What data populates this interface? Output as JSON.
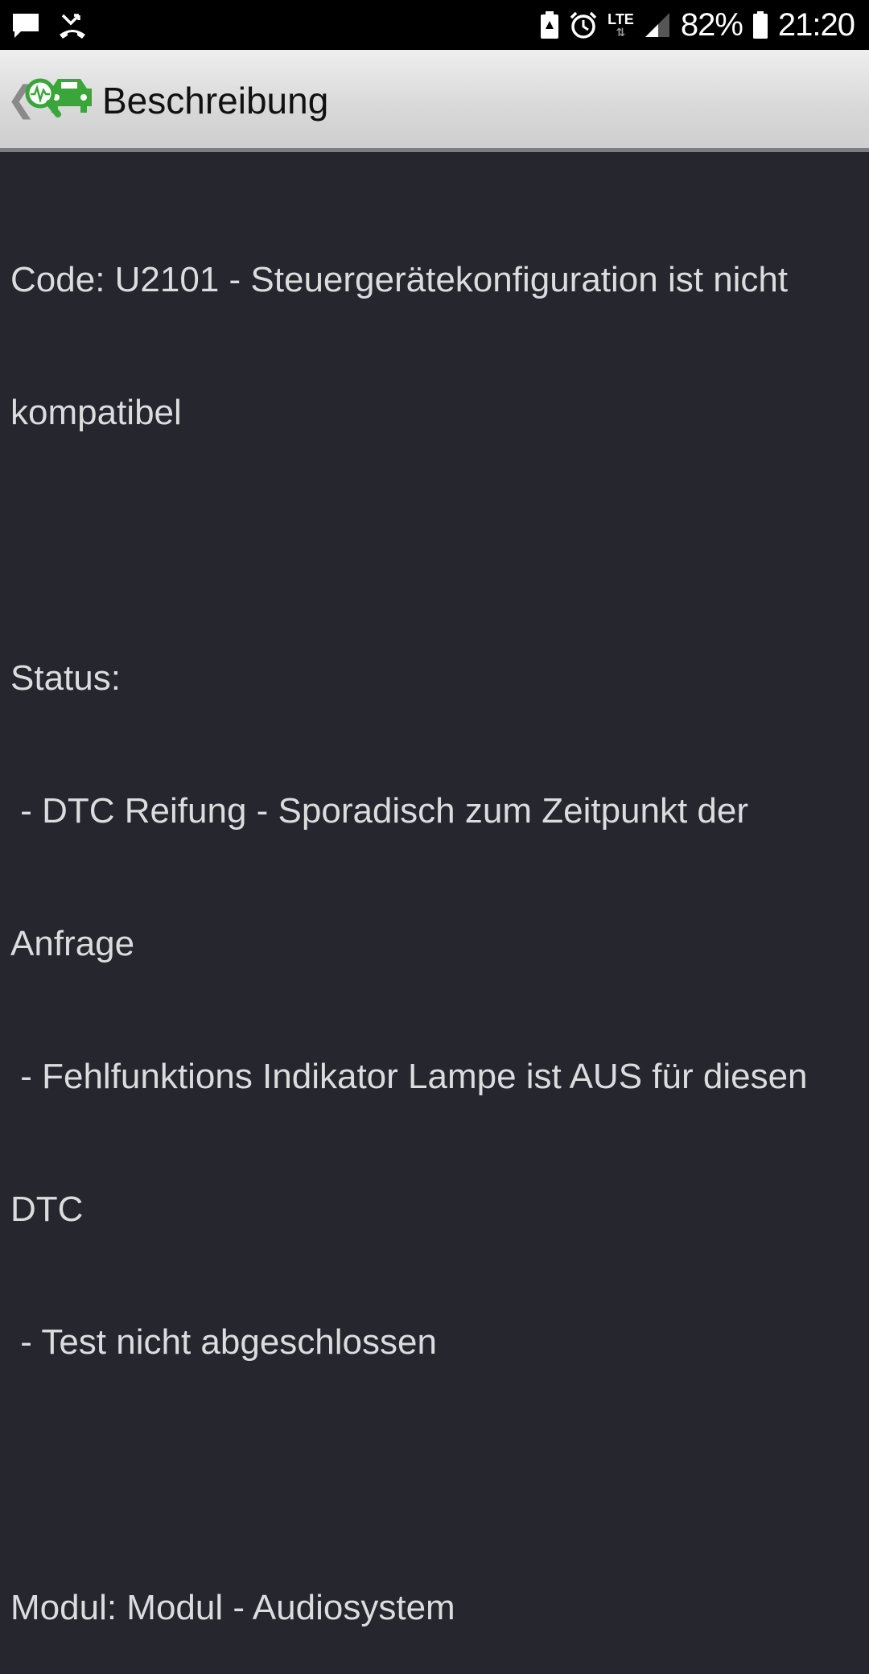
{
  "status_bar": {
    "left_icons": [
      "chat-icon",
      "missed-call-icon"
    ],
    "right_icons": [
      "battery-saver-icon",
      "alarm-icon",
      "lte-icon",
      "signal-icon",
      "battery-icon"
    ],
    "network": "LTE",
    "battery_percent": "82%",
    "time": "21:20"
  },
  "app_bar": {
    "back_icon": "chevron-left-icon",
    "logo_icon": "car-diagnostic-icon",
    "title": "Beschreibung",
    "accent_color": "#3aa63a"
  },
  "description": {
    "code_line_1": "Code: U2101 - Steuergerätekonfiguration ist nicht",
    "code_line_2": "kompatibel",
    "status_label": "Status:",
    "status_item_1_line_1": " - DTC Reifung - Sporadisch zum Zeitpunkt der",
    "status_item_1_line_2": "Anfrage",
    "status_item_2_line_1": " - Fehlfunktions Indikator Lampe ist AUS für diesen",
    "status_item_2_line_2": "DTC",
    "status_item_3": " - Test nicht abgeschlossen",
    "module_line": "Modul: Modul - Audiosystem"
  },
  "colors": {
    "background": "#25262e",
    "text": "#dcdcdc",
    "status_bar": "#000000"
  }
}
